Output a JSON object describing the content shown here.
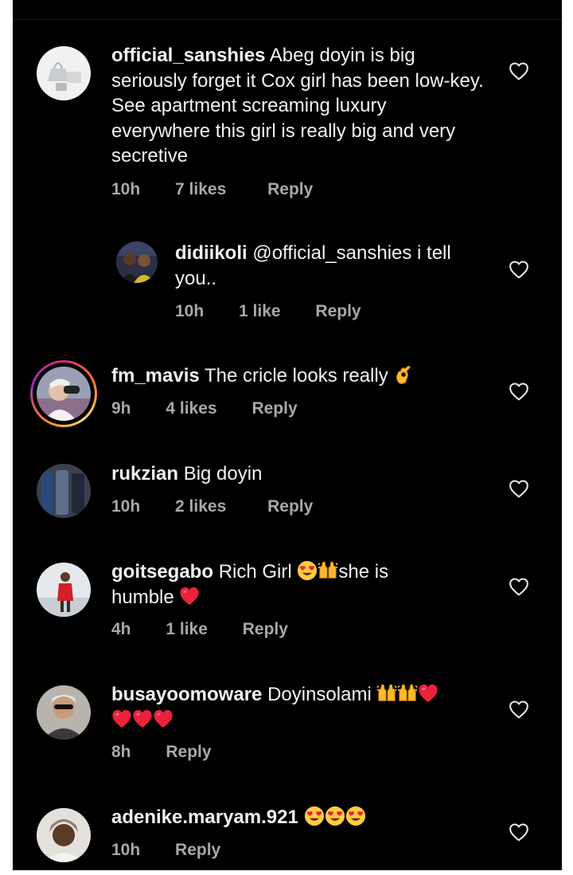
{
  "comments": [
    {
      "username": "official_sanshies",
      "text": "Abeg doyin is big seriously forget it Cox girl has been low-key. See apartment screaming luxury everywhere this girl is really big and very secretive",
      "time": "10h",
      "likes": "7 likes",
      "reply": "Reply",
      "avatar_icon": "handbag-avatar-icon"
    },
    {
      "username": "didiikoli",
      "text": "@official_sanshies i tell you..",
      "time": "10h",
      "likes": "1 like",
      "reply": "Reply",
      "avatar_icon": "couple-photo-avatar-icon"
    },
    {
      "username": "fm_mavis",
      "text": "The cricle looks really",
      "emoji": [
        "ok-hand"
      ],
      "time": "9h",
      "likes": "4 likes",
      "reply": "Reply",
      "avatar_icon": "binoculars-avatar-icon",
      "has_story_ring": true
    },
    {
      "username": "rukzian",
      "text": "Big doyin",
      "time": "10h",
      "likes": "2 likes",
      "reply": "Reply",
      "avatar_icon": "clothes-avatar-icon"
    },
    {
      "username": "goitsegabo",
      "text": "Rich Girl",
      "text2": "she is",
      "text3": "humble",
      "emoji": [
        "heart-eyes",
        "raised-hands",
        "red-heart"
      ],
      "time": "4h",
      "likes": "1 like",
      "reply": "Reply",
      "avatar_icon": "woman-red-dress-avatar-icon"
    },
    {
      "username": "busayoomoware",
      "text": "Doyinsolami",
      "emoji": [
        "raised-hands",
        "raised-hands",
        "red-heart",
        "red-heart",
        "red-heart",
        "red-heart"
      ],
      "time": "8h",
      "reply": "Reply",
      "avatar_icon": "woman-sunglasses-avatar-icon"
    },
    {
      "username": "adenike.maryam.921",
      "text": "",
      "emoji": [
        "heart-eyes",
        "heart-eyes",
        "heart-eyes"
      ],
      "time": "10h",
      "reply": "Reply",
      "avatar_icon": "woman-headwrap-avatar-icon"
    }
  ],
  "colors": {
    "background": "#000000",
    "text": "#f2f2f2",
    "meta": "#a8a8a8"
  }
}
